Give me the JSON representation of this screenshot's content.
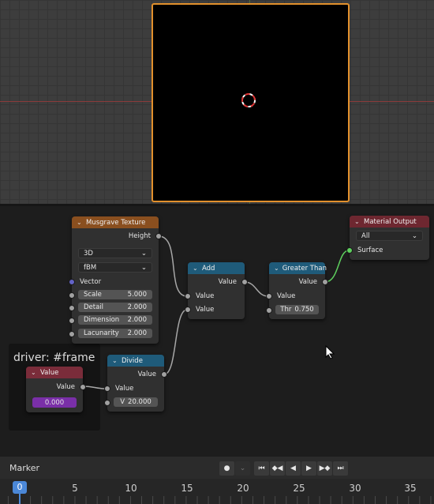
{
  "nodes": {
    "musgrave": {
      "title": "Musgrave Texture",
      "output_height": "Height",
      "dimensions_select": "3D",
      "type_select": "fBM",
      "input_vector": "Vector",
      "fields": [
        {
          "label": "Scale",
          "value": "5.000"
        },
        {
          "label": "Detail",
          "value": "2.000"
        },
        {
          "label": "Dimension",
          "value": "2.000"
        },
        {
          "label": "Lacunarity",
          "value": "2.000"
        }
      ]
    },
    "add": {
      "title": "Add",
      "output": "Value",
      "input1": "Value",
      "input2": "Value"
    },
    "greater_than": {
      "title": "Greater Than",
      "output": "Value",
      "input": "Value",
      "thr_label": "Thr",
      "thr_value": "0.750"
    },
    "material_output": {
      "title": "Material Output",
      "target_select": "All",
      "input_surface": "Surface"
    },
    "divide": {
      "title": "Divide",
      "output": "Value",
      "input": "Value",
      "v_label": "V",
      "v_value": "20.000"
    },
    "value": {
      "title": "Value",
      "output": "Value",
      "value": "0.000"
    }
  },
  "frame": {
    "label": "driver: #frame"
  },
  "timeline": {
    "marker_label": "Marker",
    "current_frame": "0",
    "ticks": [
      "5",
      "10",
      "15",
      "20",
      "25",
      "30",
      "35"
    ]
  },
  "colors": {
    "camera_border": "#e2902c",
    "texture_header": "#8a4f1f",
    "converter_header": "#1f5b7a",
    "output_header": "#6e2730",
    "value_field": "#7a2fa8",
    "playhead": "#4b88d8"
  },
  "icons": {
    "record": "record-icon",
    "jump_start": "jump-start-icon",
    "prev_keyframe": "prev-keyframe-icon",
    "play_reverse": "play-reverse-icon",
    "play": "play-icon",
    "next_keyframe": "next-keyframe-icon",
    "jump_end": "jump-end-icon"
  }
}
